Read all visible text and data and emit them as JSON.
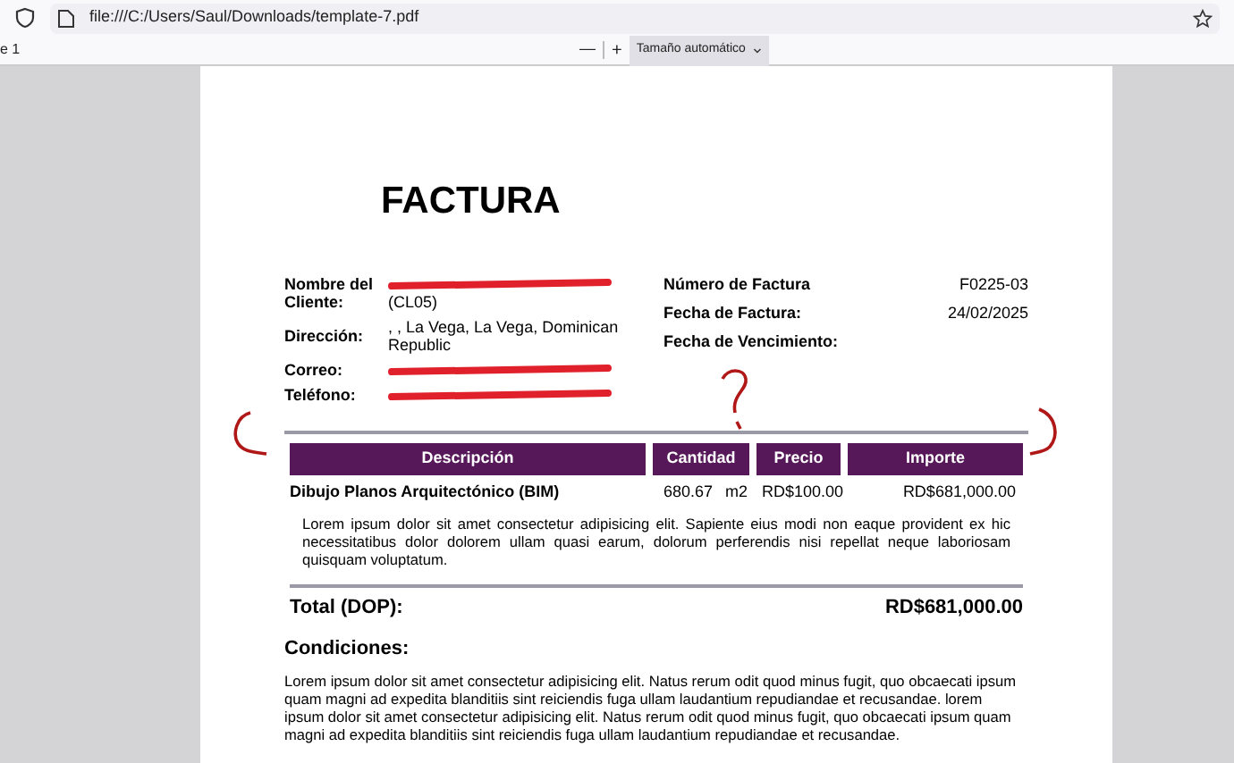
{
  "browser": {
    "url": "file:///C:/Users/Saul/Downloads/template-7.pdf"
  },
  "pdf_toolbar": {
    "page_label": "e 1",
    "zoom_out": "—",
    "zoom_in": "+",
    "zoom_select": "Tamaño automático"
  },
  "invoice": {
    "title": "FACTURA",
    "client_fields": [
      {
        "label": "Nombre del Cliente:",
        "value": "(CL05)",
        "redacted": true
      },
      {
        "label": "Dirección:",
        "value": ", , La Vega, La Vega, Dominican Republic",
        "redacted": false
      },
      {
        "label": "Correo:",
        "redacted": true
      },
      {
        "label": "Teléfono:",
        "redacted": true
      }
    ],
    "invoice_fields": [
      {
        "label": "Número de Factura",
        "value": "F0225-03"
      },
      {
        "label": "Fecha de Factura:",
        "value": "24/02/2025"
      },
      {
        "label": "Fecha de Vencimiento:"
      }
    ],
    "table": {
      "columns": [
        "Descripción",
        "Cantidad",
        "Precio",
        "Importe"
      ],
      "rows": [
        {
          "description": "Dibujo Planos Arquitectónico (BIM)",
          "quantity": "680.67",
          "unit": "m2",
          "price": "RD$100.00",
          "amount": "RD$681,000.00",
          "note": "Lorem ipsum dolor sit amet consectetur adipisicing elit. Sapiente eius modi non eaque provident ex hic necessitatibus dolor dolorem ullam quasi earum, dolorum perferendis nisi repellat neque laboriosam quisquam voluptatum."
        }
      ]
    },
    "total_label": "Total (DOP):",
    "total_value": "RD$681,000.00",
    "conditions_title": "Condiciones:",
    "conditions_text": "Lorem ipsum dolor sit amet consectetur adipisicing elit. Natus rerum odit quod minus fugit, quo obcaecati ipsum quam magni ad expedita blanditiis sint reiciendis fuga ullam laudantium repudiandae et recusandae. lorem ipsum dolor sit amet consectetur adipisicing elit. Natus rerum odit quod minus fugit, quo obcaecati ipsum quam magni ad expedita blanditiis sint reiciendis fuga ullam laudantium repudiandae et recusandae."
  }
}
